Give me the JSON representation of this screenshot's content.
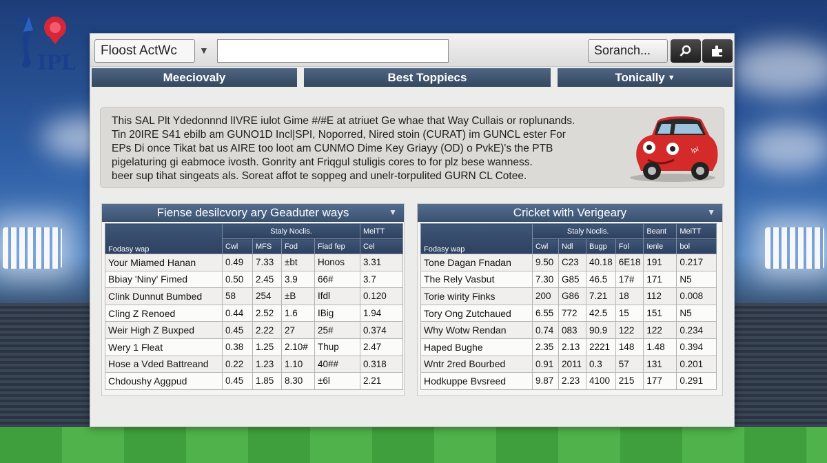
{
  "background": {
    "theme": "cricket-stadium",
    "colors": {
      "sky": "#2f5fa6",
      "pitch": "#3f9f3c"
    }
  },
  "logo": {
    "text": "IPL",
    "icon": "ipl-logo-icon"
  },
  "toolbar": {
    "select_value": "Floost ActWc",
    "url_value": "",
    "search_label": "Soranch...",
    "search_icon": "magnifier-icon",
    "extra_icon": "puzzle-icon"
  },
  "nav": {
    "tabs": [
      {
        "label": "Meeciovaly"
      },
      {
        "label": "Best Toppiecs"
      },
      {
        "label": "Tonically"
      }
    ]
  },
  "info": {
    "lines": [
      "This SAL Plt Ydedonnnd lIVRE iulot Gime #/#E at atriuet Ge whae that Way Cullais or roplunands.",
      "Tin 20IRE S41 ebilb am GUNO1D Incl|SPI, Noporred, Nired stoin (CURAT) im GUNCL ester For",
      "EPs Di once Tikat bat us AIRE too loot am CUNMO Dime Key Griayy (OD) o PvkE)'s the PTB",
      "pigelaturing gi eabmoce ivosth. Gonrity ant Friqgul stuligis cores to for plz bese wanness.",
      "beer sup tihat singeats als. Soreat affot te soppeg and unelr-torpulited GURN CL Cotee."
    ],
    "image_icon": "red-car-icon"
  },
  "left_table": {
    "title": "Fiense desilcvory ary Geaduter ways",
    "group_header": "Staly Noclis.",
    "extra_header": "MeiTT",
    "columns": [
      "Fodasy wap",
      "Cwl",
      "MFS",
      "Fod",
      "Fiad fep",
      "Cel"
    ],
    "rows": [
      [
        "Your Miamed Hanan",
        "0.49",
        "7.33",
        "±bt",
        "Honos",
        "3.31"
      ],
      [
        "Bbiay 'Niny' Fimed",
        "0.50",
        "2.45",
        "3.9",
        "66#",
        "3.7"
      ],
      [
        "Clink Dunnut Bumbed",
        "58",
        "254",
        "±B",
        "Ifdl",
        "0.120"
      ],
      [
        "Cling Z Renoed",
        "0.44",
        "2.52",
        "1.6",
        "IBig",
        "1.94"
      ],
      [
        "Weir High Z Buxped",
        "0.45",
        "2.22",
        "27",
        "25#",
        "0.374"
      ],
      [
        "Wery 1 Fleat",
        "0.38",
        "1.25",
        "2.10#",
        "Thup",
        "2.47"
      ],
      [
        "Hose a Vded Battreand",
        "0.22",
        "1.23",
        "1.10",
        "40##",
        "0.318"
      ],
      [
        "Chdoushy Aggpud",
        "0.45",
        "1.85",
        "8.30",
        "±6l",
        "2.21"
      ]
    ]
  },
  "right_table": {
    "title": "Cricket with Verigeary",
    "group_header": "Staly Noclis.",
    "extra_headers": [
      "Beant",
      "MeiTT"
    ],
    "columns": [
      "Fodasy wap",
      "Cwl",
      "Ndl",
      "Bugp",
      "Fol",
      "Ienle",
      "bol"
    ],
    "rows": [
      [
        "Tone Dagan Fnadan",
        "9.50",
        "C23",
        "40.18",
        "6E18",
        "191",
        "0.217"
      ],
      [
        "The Rely Vasbut",
        "7.30",
        "G85",
        "46.5",
        "17#",
        "171",
        "N5"
      ],
      [
        "Torie wirity Finks",
        "200",
        "G86",
        "7.21",
        "18",
        "112",
        "0.008"
      ],
      [
        "Tory Ong Zutchaued",
        "6.55",
        "772",
        "42.5",
        "15",
        "151",
        "N5"
      ],
      [
        "Why Wotw Rendan",
        "0.74",
        "083",
        "90.9",
        "122",
        "122",
        "0.234"
      ],
      [
        "Haped Bughe",
        "2.35",
        "2.13",
        "2221",
        "148",
        "1.48",
        "0.394"
      ],
      [
        "Wntr 2red Bourbed",
        "0.91",
        "2011",
        "0.3",
        "57",
        "131",
        "0.201"
      ],
      [
        "Hodkuppe Bvsreed",
        "9.87",
        "2.23",
        "4100",
        "215",
        "177",
        "0.291"
      ]
    ]
  }
}
